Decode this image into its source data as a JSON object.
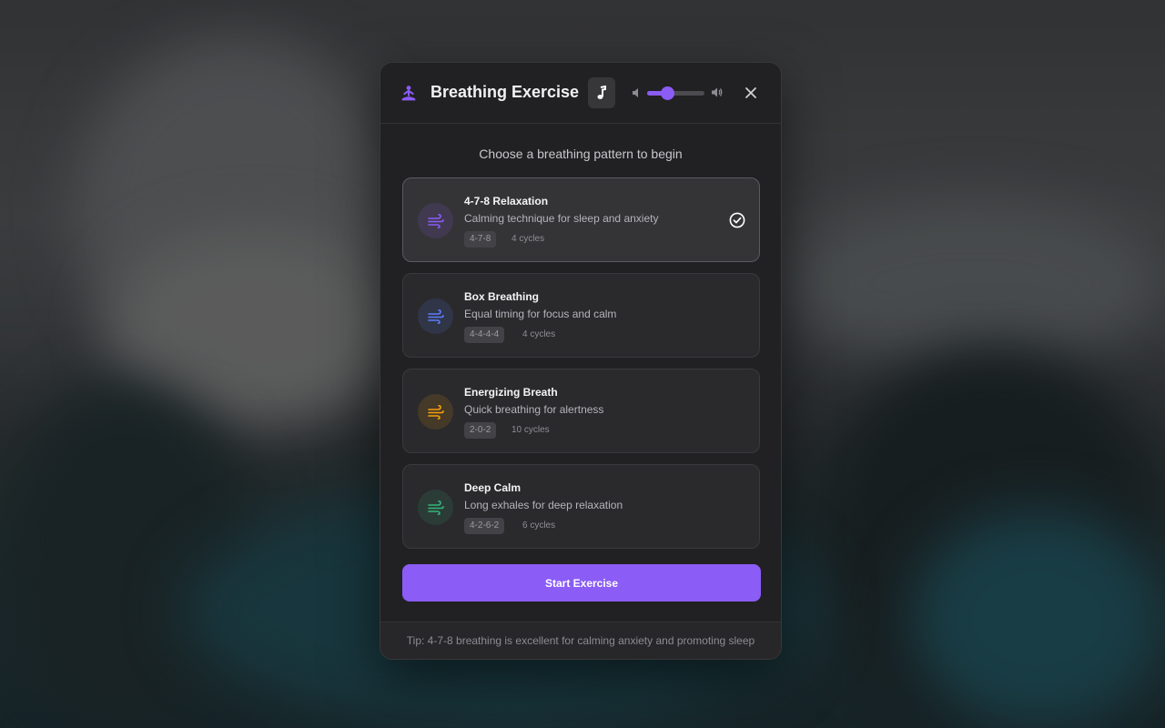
{
  "app": {
    "title": "Breathing Exercise",
    "accent_color": "#8b5cf6"
  },
  "header": {
    "music_icon": "music-note-icon",
    "volume_level_percent": 35,
    "close_icon": "close-icon"
  },
  "main": {
    "prompt": "Choose a breathing pattern to begin",
    "patterns": [
      {
        "name": "4-7-8 Relaxation",
        "description": "Calming technique for sleep and anxiety",
        "timing": "4-7-8",
        "cycles": "4 cycles",
        "color": "#8b5cf6",
        "selected": true
      },
      {
        "name": "Box Breathing",
        "description": "Equal timing for focus and calm",
        "timing": "4-4-4-4",
        "cycles": "4 cycles",
        "color": "#5b7cf6",
        "selected": false
      },
      {
        "name": "Energizing Breath",
        "description": "Quick breathing for alertness",
        "timing": "2-0-2",
        "cycles": "10 cycles",
        "color": "#f59e0b",
        "selected": false
      },
      {
        "name": "Deep Calm",
        "description": "Long exhales for deep relaxation",
        "timing": "4-2-6-2",
        "cycles": "6 cycles",
        "color": "#34b37a",
        "selected": false
      }
    ],
    "start_label": "Start Exercise"
  },
  "footer": {
    "tip": "Tip: 4-7-8 breathing is excellent for calming anxiety and promoting sleep"
  }
}
